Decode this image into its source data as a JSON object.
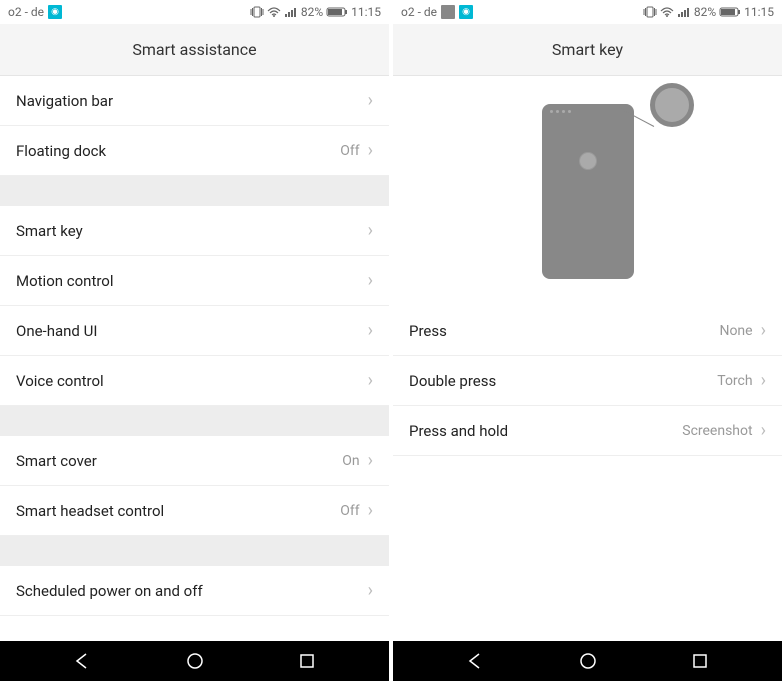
{
  "left_screen": {
    "status": {
      "carrier": "o2 - de",
      "battery": "82%",
      "time": "11:15"
    },
    "title": "Smart assistance",
    "items": [
      {
        "label": "Navigation bar",
        "value": ""
      },
      {
        "label": "Floating dock",
        "value": "Off"
      }
    ],
    "items2": [
      {
        "label": "Smart key",
        "value": ""
      },
      {
        "label": "Motion control",
        "value": ""
      },
      {
        "label": "One-hand UI",
        "value": ""
      },
      {
        "label": "Voice control",
        "value": ""
      }
    ],
    "items3": [
      {
        "label": "Smart cover",
        "value": "On"
      },
      {
        "label": "Smart headset control",
        "value": "Off"
      }
    ],
    "items4": [
      {
        "label": "Scheduled power on and off",
        "value": ""
      }
    ]
  },
  "right_screen": {
    "status": {
      "carrier": "o2 - de",
      "battery": "82%",
      "time": "11:15"
    },
    "title": "Smart key",
    "items": [
      {
        "label": "Press",
        "value": "None"
      },
      {
        "label": "Double press",
        "value": "Torch"
      },
      {
        "label": "Press and hold",
        "value": "Screenshot"
      }
    ]
  }
}
